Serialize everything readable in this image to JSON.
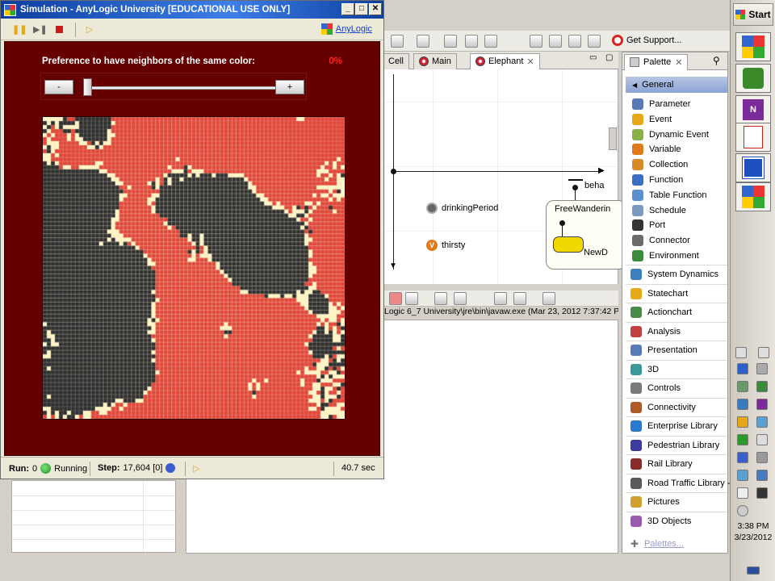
{
  "simulation": {
    "title": "Simulation - AnyLogic University  [EDUCATIONAL USE ONLY]",
    "toolbar": {
      "pause_icon": "pause-icon",
      "step_icon": "step-icon",
      "stop_icon": "stop-icon",
      "speed_icon": "speed-icon",
      "anylogic_link": "AnyLogic"
    },
    "preference_label": "Preference to have neighbors of the same color:",
    "preference_value": "0%",
    "slider": {
      "minus_label": "-",
      "plus_label": "+",
      "value": 0
    },
    "grid": {
      "cols": 75,
      "rows": 75,
      "colors": {
        "red": "#e0483a",
        "black": "#303030",
        "cream": "#fdf3c4",
        "background": "#640000"
      }
    },
    "status": {
      "run_label": "Run:",
      "run_value": "0",
      "run_state": "Running",
      "step_label": "Step:",
      "step_value": "17,604 [0]",
      "time": "40.7 sec"
    }
  },
  "editor": {
    "tabs": [
      {
        "label": "Cell"
      },
      {
        "label": "Main"
      },
      {
        "label": "Elephant",
        "active": true
      }
    ],
    "canvas": {
      "params": [
        {
          "label": "drinkingPeriod",
          "icon": "event-clock-icon"
        },
        {
          "label": "thirsty",
          "icon": "variable-icon"
        }
      ],
      "statechart_label": "FreeWanderin",
      "behavior_label": "beha",
      "state_label": "NewD"
    },
    "console_text": "Logic 6_7 University\\jre\\bin\\javaw.exe (Mar 23, 2012 7:37:42 P",
    "support_label": "Get Support..."
  },
  "palette": {
    "tab_label": "Palette",
    "general_label": "General",
    "general_items": [
      {
        "label": "Parameter",
        "color": "#5a7ab5"
      },
      {
        "label": "Event",
        "color": "#e6a817"
      },
      {
        "label": "Dynamic Event",
        "color": "#8ab04a"
      },
      {
        "label": "Variable",
        "color": "#e07b1b"
      },
      {
        "label": "Collection",
        "color": "#d88a2a"
      },
      {
        "label": "Function",
        "color": "#3a6fc4"
      },
      {
        "label": "Table Function",
        "color": "#5b8fd0"
      },
      {
        "label": "Schedule",
        "color": "#7a9ac0"
      },
      {
        "label": "Port",
        "color": "#333333"
      },
      {
        "label": "Connector",
        "color": "#6a6a6a"
      },
      {
        "label": "Environment",
        "color": "#3c8a3c"
      }
    ],
    "categories": [
      {
        "label": "System Dynamics",
        "color": "#3d7fbf"
      },
      {
        "label": "Statechart",
        "color": "#e6a817"
      },
      {
        "label": "Actionchart",
        "color": "#4a8a4a"
      },
      {
        "label": "Analysis",
        "color": "#c04040"
      },
      {
        "label": "Presentation",
        "color": "#5a7ab5"
      },
      {
        "label": "3D",
        "color": "#3a9a9a"
      },
      {
        "label": "Controls",
        "color": "#7a7a7a"
      },
      {
        "label": "Connectivity",
        "color": "#b05a2a"
      },
      {
        "label": "Enterprise Library",
        "color": "#2a7ad0"
      },
      {
        "label": "Pedestrian Library",
        "color": "#3a3aa0"
      },
      {
        "label": "Rail Library",
        "color": "#8a2a2a"
      },
      {
        "label": "Road Traffic Library - F",
        "color": "#5a5a5a"
      },
      {
        "label": "Pictures",
        "color": "#d0a030"
      },
      {
        "label": "3D Objects",
        "color": "#9a5ab0"
      }
    ],
    "more_link": "Palettes..."
  },
  "taskbar": {
    "start_label": "Start",
    "clock_time": "3:38 PM",
    "clock_date": "3/23/2012"
  }
}
